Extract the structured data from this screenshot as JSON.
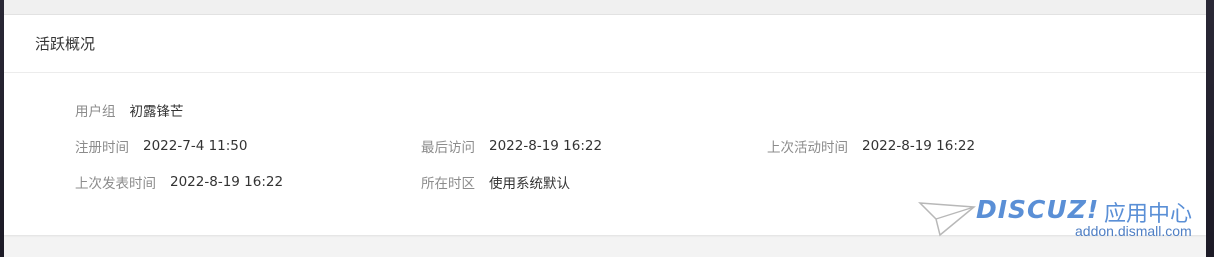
{
  "section": {
    "title": "活跃概况"
  },
  "rows": [
    {
      "items": [
        {
          "label": "用户组",
          "value": "初露锋芒"
        }
      ]
    },
    {
      "items": [
        {
          "label": "注册时间",
          "value": "2022-7-4 11:50"
        },
        {
          "label": "最后访问",
          "value": "2022-8-19 16:22"
        },
        {
          "label": "上次活动时间",
          "value": "2022-8-19 16:22"
        }
      ]
    },
    {
      "items": [
        {
          "label": "上次发表时间",
          "value": "2022-8-19 16:22"
        },
        {
          "label": "所在时区",
          "value": "使用系统默认"
        }
      ]
    }
  ],
  "watermark": {
    "brand": "DISCUZ!",
    "suffix": "应用中心",
    "url": "addon.dismall.com",
    "color": "#5a8fd6",
    "icon": "paper-plane-icon"
  }
}
